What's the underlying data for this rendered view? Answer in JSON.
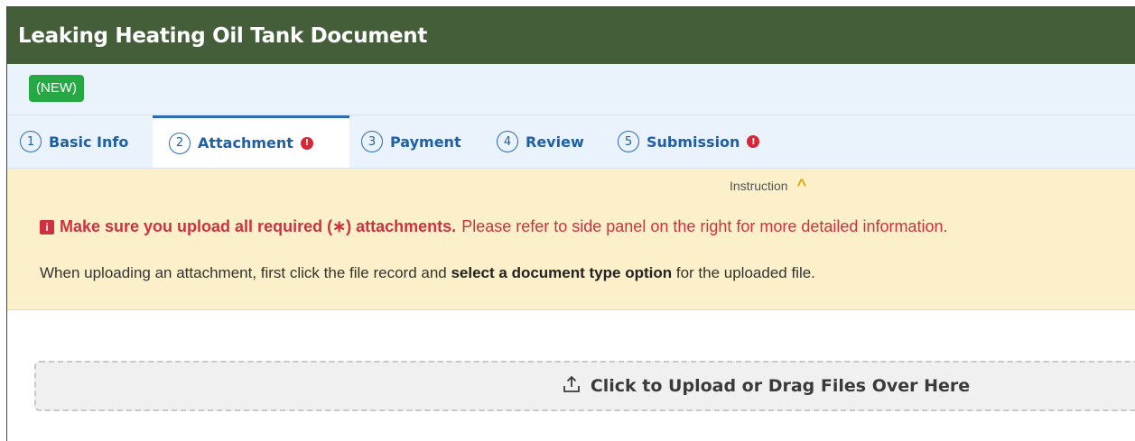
{
  "window": {
    "title": "Leaking Heating Oil Tank Document"
  },
  "status": {
    "badge": "(NEW)"
  },
  "tabs": [
    {
      "num": "1",
      "label": "Basic Info",
      "error": false,
      "active": false
    },
    {
      "num": "2",
      "label": "Attachment",
      "error": true,
      "active": true
    },
    {
      "num": "3",
      "label": "Payment",
      "error": false,
      "active": false
    },
    {
      "num": "4",
      "label": "Review",
      "error": false,
      "active": false
    },
    {
      "num": "5",
      "label": "Submission",
      "error": true,
      "active": false
    }
  ],
  "instruction": {
    "toggle_label": "Instruction",
    "toggle_icon": "chevron-up-icon",
    "warning_icon": "info-square-icon",
    "warning_strong": "Make sure you upload all required (∗) attachments.",
    "warning_rest": "Please refer to side panel on the right for more detailed information.",
    "line2_pre": "When uploading an attachment, first click the file record and ",
    "line2_bold": "select a document type option",
    "line2_post": " for the uploaded file."
  },
  "upload": {
    "icon": "upload-icon",
    "label": "Click to Upload or Drag Files Over Here"
  },
  "colors": {
    "title_bar": "#445e3a",
    "badge_green": "#26a844",
    "tab_blue": "#1f5fa3",
    "error_red": "#d72638",
    "instruction_bg": "#fbf0c9"
  }
}
